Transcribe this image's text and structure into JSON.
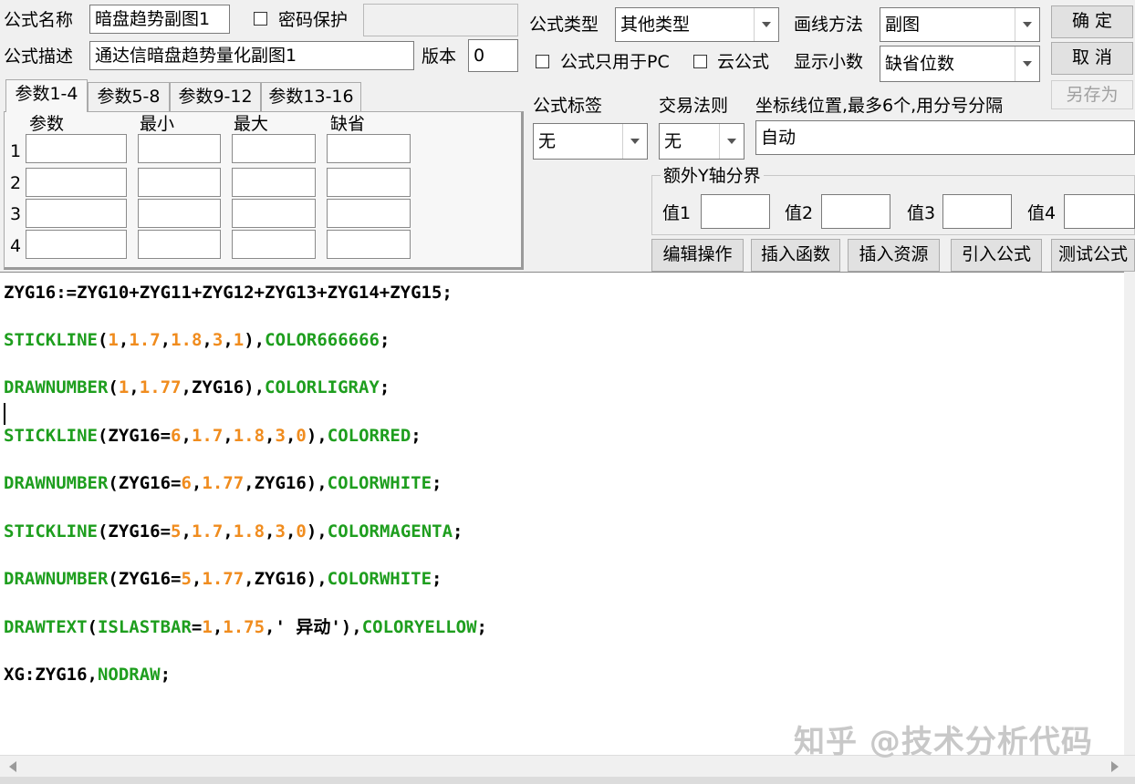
{
  "header": {
    "name_label": "公式名称",
    "name_value": "暗盘趋势副图1",
    "password_label": "密码保护",
    "password_value": "",
    "desc_label": "公式描述",
    "desc_value": "通达信暗盘趋势量化副图1",
    "version_label": "版本",
    "version_value": "0",
    "type_label": "公式类型",
    "type_value": "其他类型",
    "draw_label": "画线方法",
    "draw_value": "副图",
    "pc_only_label": "公式只用于PC",
    "cloud_label": "云公式",
    "decimals_label": "显示小数",
    "decimals_value": "缺省位数"
  },
  "buttons": {
    "ok": "确 定",
    "cancel": "取 消",
    "save_as": "另存为",
    "edit_ops": "编辑操作",
    "insert_func": "插入函数",
    "insert_res": "插入资源",
    "import_formula": "引入公式",
    "test_formula": "测试公式"
  },
  "tabs": [
    "参数1-4",
    "参数5-8",
    "参数9-12",
    "参数13-16"
  ],
  "params": {
    "headers": [
      "参数",
      "最小",
      "最大",
      "缺省"
    ],
    "rows": [
      "1",
      "2",
      "3",
      "4"
    ]
  },
  "options": {
    "tag_label": "公式标签",
    "tag_value": "无",
    "trade_label": "交易法则",
    "trade_value": "无",
    "axis_label": "坐标线位置,最多6个,用分号分隔",
    "axis_value": "自动",
    "extra_y_label": "额外Y轴分界",
    "val_labels": [
      "值1",
      "值2",
      "值3",
      "值4"
    ]
  },
  "code": [
    [
      [
        "k",
        "ZYG16:=ZYG10+ZYG11+ZYG12+ZYG13+ZYG14+ZYG15;"
      ]
    ],
    [
      [
        "g",
        "STICKLINE"
      ],
      [
        "k",
        "("
      ],
      [
        "o",
        "1"
      ],
      [
        "k",
        ","
      ],
      [
        "o",
        "1.7"
      ],
      [
        "k",
        ","
      ],
      [
        "o",
        "1.8"
      ],
      [
        "k",
        ","
      ],
      [
        "o",
        "3"
      ],
      [
        "k",
        ","
      ],
      [
        "o",
        "1"
      ],
      [
        "k",
        "),"
      ],
      [
        "g",
        "COLOR666666"
      ],
      [
        "k",
        ";"
      ]
    ],
    [
      [
        "g",
        "DRAWNUMBER"
      ],
      [
        "k",
        "("
      ],
      [
        "o",
        "1"
      ],
      [
        "k",
        ","
      ],
      [
        "o",
        "1.77"
      ],
      [
        "k",
        ",ZYG16),"
      ],
      [
        "g",
        "COLORLIGRAY"
      ],
      [
        "k",
        ";"
      ]
    ],
    [
      [
        "g",
        "STICKLINE"
      ],
      [
        "k",
        "(ZYG16="
      ],
      [
        "o",
        "6"
      ],
      [
        "k",
        ","
      ],
      [
        "o",
        "1.7"
      ],
      [
        "k",
        ","
      ],
      [
        "o",
        "1.8"
      ],
      [
        "k",
        ","
      ],
      [
        "o",
        "3"
      ],
      [
        "k",
        ","
      ],
      [
        "o",
        "0"
      ],
      [
        "k",
        "),"
      ],
      [
        "g",
        "COLORRED"
      ],
      [
        "k",
        ";"
      ]
    ],
    [
      [
        "g",
        "DRAWNUMBER"
      ],
      [
        "k",
        "(ZYG16="
      ],
      [
        "o",
        "6"
      ],
      [
        "k",
        ","
      ],
      [
        "o",
        "1.77"
      ],
      [
        "k",
        ",ZYG16),"
      ],
      [
        "g",
        "COLORWHITE"
      ],
      [
        "k",
        ";"
      ]
    ],
    [
      [
        "g",
        "STICKLINE"
      ],
      [
        "k",
        "(ZYG16="
      ],
      [
        "o",
        "5"
      ],
      [
        "k",
        ","
      ],
      [
        "o",
        "1.7"
      ],
      [
        "k",
        ","
      ],
      [
        "o",
        "1.8"
      ],
      [
        "k",
        ","
      ],
      [
        "o",
        "3"
      ],
      [
        "k",
        ","
      ],
      [
        "o",
        "0"
      ],
      [
        "k",
        "),"
      ],
      [
        "g",
        "COLORMAGENTA"
      ],
      [
        "k",
        ";"
      ]
    ],
    [
      [
        "g",
        "DRAWNUMBER"
      ],
      [
        "k",
        "(ZYG16="
      ],
      [
        "o",
        "5"
      ],
      [
        "k",
        ","
      ],
      [
        "o",
        "1.77"
      ],
      [
        "k",
        ",ZYG16),"
      ],
      [
        "g",
        "COLORWHITE"
      ],
      [
        "k",
        ";"
      ]
    ],
    [
      [
        "g",
        "DRAWTEXT"
      ],
      [
        "k",
        "("
      ],
      [
        "g",
        "ISLASTBAR"
      ],
      [
        "k",
        "="
      ],
      [
        "o",
        "1"
      ],
      [
        "k",
        ","
      ],
      [
        "o",
        "1.75"
      ],
      [
        "k",
        ",' 异动'),"
      ],
      [
        "g",
        "COLORYELLOW"
      ],
      [
        "k",
        ";"
      ]
    ],
    [
      [
        "k",
        "XG:ZYG16,"
      ],
      [
        "g",
        "NODRAW"
      ],
      [
        "k",
        ";"
      ]
    ]
  ],
  "watermark": "知乎 @技术分析代码",
  "colors": {
    "keyword": "#1e9e1e",
    "number": "#f08c1e",
    "text": "#000000"
  }
}
